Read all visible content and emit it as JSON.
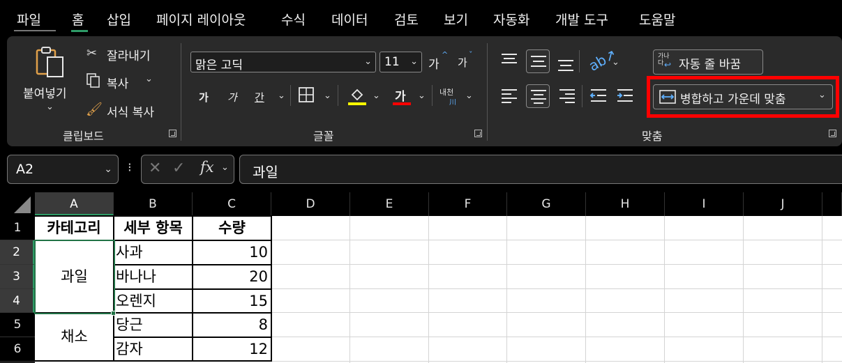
{
  "menu": {
    "tabs": [
      "파일",
      "홈",
      "삽입",
      "페이지 레이아웃",
      "수식",
      "데이터",
      "검토",
      "보기",
      "자동화",
      "개발 도구",
      "도움말"
    ],
    "active": "홈"
  },
  "ribbon": {
    "clipboard": {
      "paste": "붙여넣기",
      "cut": "잘라내기",
      "copy": "복사",
      "format_painter": "서식 복사",
      "label": "클립보드"
    },
    "font": {
      "font_name": "맑은 고딕",
      "font_size": "11",
      "grow": "가",
      "shrink": "가",
      "bold": "가",
      "italic": "가",
      "underline": "간",
      "font_color_glyph": "가",
      "phonetic": "내천",
      "label": "글꼴",
      "fill_color": "#ffff00",
      "font_color": "#ff0000"
    },
    "alignment": {
      "wrap_text": "자동 줄 바꿈",
      "wrap_icon_text": "가나\n다",
      "merge_center": "병합하고 가운데 맞춤",
      "label": "맞춤"
    }
  },
  "formula_bar": {
    "name_box": "A2",
    "fx": "fx",
    "formula": "과일"
  },
  "sheet": {
    "columns": [
      "A",
      "B",
      "C",
      "D",
      "E",
      "F",
      "G",
      "H",
      "I",
      "J"
    ],
    "rows": [
      "1",
      "2",
      "3",
      "4",
      "5",
      "6"
    ],
    "header": [
      "카테고리",
      "세부 항목",
      "수량"
    ],
    "merged_a2_a4": "과일",
    "merged_a5_a6": "채소",
    "items": [
      {
        "name": "사과",
        "qty": "10"
      },
      {
        "name": "바나나",
        "qty": "20"
      },
      {
        "name": "오렌지",
        "qty": "15"
      },
      {
        "name": "당근",
        "qty": "8"
      },
      {
        "name": "감자",
        "qty": "12"
      }
    ]
  },
  "colors": {
    "accent": "#2e9b67",
    "highlight": "#ff0000"
  }
}
